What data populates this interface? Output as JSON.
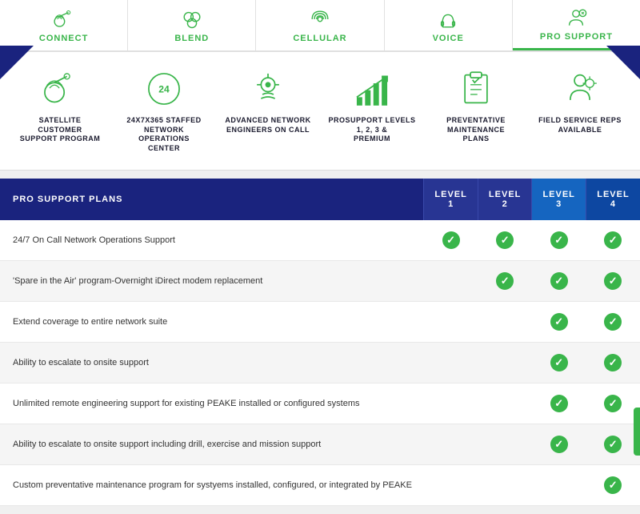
{
  "tabs": [
    {
      "id": "connect",
      "label": "CONNECT",
      "active": false
    },
    {
      "id": "blend",
      "label": "BLEND",
      "active": false
    },
    {
      "id": "cellular",
      "label": "CELLULAR",
      "active": false
    },
    {
      "id": "voice",
      "label": "VOICE",
      "active": false
    },
    {
      "id": "pro-support",
      "label": "PRO SUPPORT",
      "active": true
    }
  ],
  "features": [
    {
      "id": "satellite",
      "label": "SATELLITE CUSTOMER\nSUPPORT PROGRAM"
    },
    {
      "id": "staffed",
      "label": "24X7X365 STAFFED\nNETWORK OPERATIONS\nCENTER"
    },
    {
      "id": "advanced",
      "label": "ADVANCED NETWORK\nENGINEERS ON CALL"
    },
    {
      "id": "prosupport",
      "label": "PROSUPPORT LEVELS 1, 2, 3 &\nPREMIUM"
    },
    {
      "id": "preventative",
      "label": "PREVENTATIVE MAINTENANCE\nPLANS"
    },
    {
      "id": "field",
      "label": "FIELD SERVICE REPS\nAVAILABLE"
    }
  ],
  "table": {
    "header": {
      "plans_label": "PRO SUPPORT PLANS",
      "level1": "LEVEL 1",
      "level2": "LEVEL 2",
      "level3": "LEVEL 3",
      "level4": "LEVEL 4"
    },
    "rows": [
      {
        "label": "24/7 On Call Network Operations Support",
        "checks": [
          true,
          true,
          true,
          true
        ]
      },
      {
        "label": "'Spare in the Air' program-Overnight iDirect modem replacement",
        "checks": [
          false,
          true,
          true,
          true
        ]
      },
      {
        "label": "Extend coverage to entire network suite",
        "checks": [
          false,
          false,
          true,
          true
        ]
      },
      {
        "label": "Ability to escalate to onsite support",
        "checks": [
          false,
          false,
          true,
          true
        ]
      },
      {
        "label": "Unlimited remote engineering support for existing PEAKE installed or configured systems",
        "checks": [
          false,
          false,
          true,
          true
        ]
      },
      {
        "label": "Ability to escalate to onsite support including drill, exercise and mission support",
        "checks": [
          false,
          false,
          true,
          true
        ]
      },
      {
        "label": "Custom preventative maintenance program for systyems installed, configured, or integrated by PEAKE",
        "checks": [
          false,
          false,
          false,
          true
        ]
      }
    ]
  }
}
